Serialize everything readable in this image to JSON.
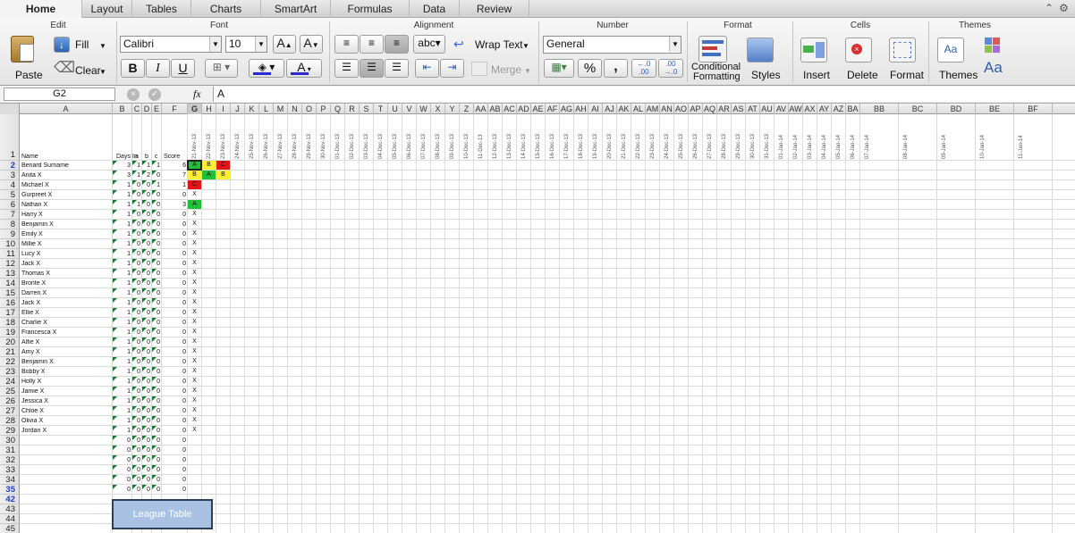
{
  "tabs": [
    "Home",
    "Layout",
    "Tables",
    "Charts",
    "SmartArt",
    "Formulas",
    "Data",
    "Review"
  ],
  "ribbon": {
    "groups": {
      "edit": "Edit",
      "font": "Font",
      "alignment": "Alignment",
      "number": "Number",
      "format": "Format",
      "cells": "Cells",
      "themes": "Themes"
    },
    "paste": "Paste",
    "fill": "Fill",
    "clear": "Clear",
    "font_name": "Calibri",
    "font_size": "10",
    "wrap_text": "Wrap Text",
    "merge": "Merge",
    "number_format": "General",
    "conditional_formatting_1": "Conditional",
    "conditional_formatting_2": "Formatting",
    "styles": "Styles",
    "insert": "Insert",
    "delete": "Delete",
    "format": "Format",
    "themes": "Themes",
    "bold": "B",
    "italic": "I",
    "underline": "U",
    "percent": "%",
    "comma": ",",
    "abc": "abc",
    "inc_decimal": "←.0\n.00",
    "aa": "Aa"
  },
  "formula_bar": {
    "name_box": "G2",
    "fx": "fx",
    "content": "A"
  },
  "columns": [
    "A",
    "B",
    "C",
    "D",
    "E",
    "F",
    "G",
    "H",
    "I",
    "J",
    "K",
    "L",
    "M",
    "N",
    "O",
    "P",
    "Q",
    "R",
    "S",
    "T",
    "U",
    "V",
    "W",
    "X",
    "Y",
    "Z",
    "AA",
    "AB",
    "AC",
    "AD",
    "AE",
    "AF",
    "AG",
    "AH",
    "AI",
    "AJ",
    "AK",
    "AL",
    "AM",
    "AN",
    "AO",
    "AP",
    "AQ",
    "AR",
    "AS",
    "AT",
    "AU",
    "AV",
    "AW",
    "AX",
    "AY",
    "AZ",
    "BA",
    "BB",
    "BC",
    "BD",
    "BE",
    "BF"
  ],
  "header_row": {
    "name": "Name",
    "days_in": "Days In",
    "a": "a",
    "b": "b",
    "c": "c",
    "score": "Score"
  },
  "dates": [
    "21-Nov-13",
    "22-Nov-13",
    "23-Nov-13",
    "24-Nov-13",
    "25-Nov-13",
    "26-Nov-13",
    "27-Nov-13",
    "28-Nov-13",
    "29-Nov-13",
    "30-Nov-13",
    "01-Dec-13",
    "02-Dec-13",
    "03-Dec-13",
    "04-Dec-13",
    "05-Dec-13",
    "06-Dec-13",
    "07-Dec-13",
    "08-Dec-13",
    "09-Dec-13",
    "10-Dec-13",
    "11-Dec-13",
    "12-Dec-13",
    "13-Dec-13",
    "14-Dec-13",
    "15-Dec-13",
    "16-Dec-13",
    "17-Dec-13",
    "18-Dec-13",
    "19-Dec-13",
    "20-Dec-13",
    "21-Dec-13",
    "22-Dec-13",
    "23-Dec-13",
    "24-Dec-13",
    "25-Dec-13",
    "26-Dec-13",
    "27-Dec-13",
    "28-Dec-13",
    "29-Dec-13",
    "30-Dec-13",
    "31-Dec-13",
    "01-Jan-14",
    "02-Jan-14",
    "03-Jan-14",
    "04-Jan-14",
    "05-Jan-14",
    "06-Jan-14",
    "07-Jan-14",
    "08-Jan-14",
    "09-Jan-14",
    "10-Jan-14",
    "11-Jan-14"
  ],
  "row_numbers": [
    "1",
    "2",
    "3",
    "4",
    "5",
    "6",
    "7",
    "8",
    "9",
    "10",
    "11",
    "12",
    "13",
    "14",
    "15",
    "16",
    "17",
    "18",
    "19",
    "20",
    "21",
    "22",
    "23",
    "24",
    "25",
    "26",
    "27",
    "28",
    "29",
    "30",
    "31",
    "32",
    "33",
    "34",
    "35",
    "42",
    "43",
    "44",
    "45"
  ],
  "rows": [
    {
      "name": "Benard Surname",
      "days": "3",
      "a": "1",
      "b": "1",
      "c": "1",
      "score": "6",
      "marks": [
        "A",
        "B",
        "C"
      ]
    },
    {
      "name": "Anita X",
      "days": "3",
      "a": "1",
      "b": "2",
      "c": "0",
      "score": "7",
      "marks": [
        "B",
        "A",
        "B"
      ]
    },
    {
      "name": "Michael X",
      "days": "1",
      "a": "0",
      "b": "0",
      "c": "1",
      "score": "1",
      "marks": [
        "C"
      ]
    },
    {
      "name": "Gurpreet X",
      "days": "1",
      "a": "0",
      "b": "0",
      "c": "0",
      "score": "0",
      "marks": [
        "X"
      ]
    },
    {
      "name": "Nathan X",
      "days": "1",
      "a": "1",
      "b": "0",
      "c": "0",
      "score": "3",
      "marks": [
        "A"
      ]
    },
    {
      "name": "Harry X",
      "days": "1",
      "a": "0",
      "b": "0",
      "c": "0",
      "score": "0",
      "marks": [
        "X"
      ]
    },
    {
      "name": "Benjamin X",
      "days": "1",
      "a": "0",
      "b": "0",
      "c": "0",
      "score": "0",
      "marks": [
        "X"
      ]
    },
    {
      "name": "Emily X",
      "days": "1",
      "a": "0",
      "b": "0",
      "c": "0",
      "score": "0",
      "marks": [
        "X"
      ]
    },
    {
      "name": "Millie X",
      "days": "1",
      "a": "0",
      "b": "0",
      "c": "0",
      "score": "0",
      "marks": [
        "X"
      ]
    },
    {
      "name": "Lucy X",
      "days": "1",
      "a": "0",
      "b": "0",
      "c": "0",
      "score": "0",
      "marks": [
        "X"
      ]
    },
    {
      "name": "Jack X",
      "days": "1",
      "a": "0",
      "b": "0",
      "c": "0",
      "score": "0",
      "marks": [
        "X"
      ]
    },
    {
      "name": "Thomas X",
      "days": "1",
      "a": "0",
      "b": "0",
      "c": "0",
      "score": "0",
      "marks": [
        "X"
      ]
    },
    {
      "name": "Bronte X",
      "days": "1",
      "a": "0",
      "b": "0",
      "c": "0",
      "score": "0",
      "marks": [
        "X"
      ]
    },
    {
      "name": "Darren X",
      "days": "1",
      "a": "0",
      "b": "0",
      "c": "0",
      "score": "0",
      "marks": [
        "X"
      ]
    },
    {
      "name": "Jack X",
      "days": "1",
      "a": "0",
      "b": "0",
      "c": "0",
      "score": "0",
      "marks": [
        "X"
      ]
    },
    {
      "name": "Ellie X",
      "days": "1",
      "a": "0",
      "b": "0",
      "c": "0",
      "score": "0",
      "marks": [
        "X"
      ]
    },
    {
      "name": "Charlie X",
      "days": "1",
      "a": "0",
      "b": "0",
      "c": "0",
      "score": "0",
      "marks": [
        "X"
      ]
    },
    {
      "name": "Francesca X",
      "days": "1",
      "a": "0",
      "b": "0",
      "c": "0",
      "score": "0",
      "marks": [
        "X"
      ]
    },
    {
      "name": "Alfie X",
      "days": "1",
      "a": "0",
      "b": "0",
      "c": "0",
      "score": "0",
      "marks": [
        "X"
      ]
    },
    {
      "name": "Amy X",
      "days": "1",
      "a": "0",
      "b": "0",
      "c": "0",
      "score": "0",
      "marks": [
        "X"
      ]
    },
    {
      "name": "Benjamin X",
      "days": "1",
      "a": "0",
      "b": "0",
      "c": "0",
      "score": "0",
      "marks": [
        "X"
      ]
    },
    {
      "name": "Bobby X",
      "days": "1",
      "a": "0",
      "b": "0",
      "c": "0",
      "score": "0",
      "marks": [
        "X"
      ]
    },
    {
      "name": "Holly X",
      "days": "1",
      "a": "0",
      "b": "0",
      "c": "0",
      "score": "0",
      "marks": [
        "X"
      ]
    },
    {
      "name": "Jamie X",
      "days": "1",
      "a": "0",
      "b": "0",
      "c": "0",
      "score": "0",
      "marks": [
        "X"
      ]
    },
    {
      "name": "Jessica X",
      "days": "1",
      "a": "0",
      "b": "0",
      "c": "0",
      "score": "0",
      "marks": [
        "X"
      ]
    },
    {
      "name": "Chloe X",
      "days": "1",
      "a": "0",
      "b": "0",
      "c": "0",
      "score": "0",
      "marks": [
        "X"
      ]
    },
    {
      "name": "Olivia X",
      "days": "1",
      "a": "0",
      "b": "0",
      "c": "0",
      "score": "0",
      "marks": [
        "X"
      ]
    },
    {
      "name": "Jordan X",
      "days": "1",
      "a": "0",
      "b": "0",
      "c": "0",
      "score": "0",
      "marks": [
        "X"
      ]
    },
    {
      "name": "",
      "days": "0",
      "a": "0",
      "b": "0",
      "c": "0",
      "score": "0",
      "marks": []
    },
    {
      "name": "",
      "days": "0",
      "a": "0",
      "b": "0",
      "c": "0",
      "score": "0",
      "marks": []
    },
    {
      "name": "",
      "days": "0",
      "a": "0",
      "b": "0",
      "c": "0",
      "score": "0",
      "marks": []
    },
    {
      "name": "",
      "days": "0",
      "a": "0",
      "b": "0",
      "c": "0",
      "score": "0",
      "marks": []
    },
    {
      "name": "",
      "days": "0",
      "a": "0",
      "b": "0",
      "c": "0",
      "score": "0",
      "marks": []
    },
    {
      "name": "",
      "days": "0",
      "a": "0",
      "b": "0",
      "c": "0",
      "score": "0",
      "marks": []
    }
  ],
  "mark_colors": {
    "A": "#1fbf3a",
    "B": "#ffee33",
    "C": "#e01515"
  },
  "league_button": "League Table"
}
